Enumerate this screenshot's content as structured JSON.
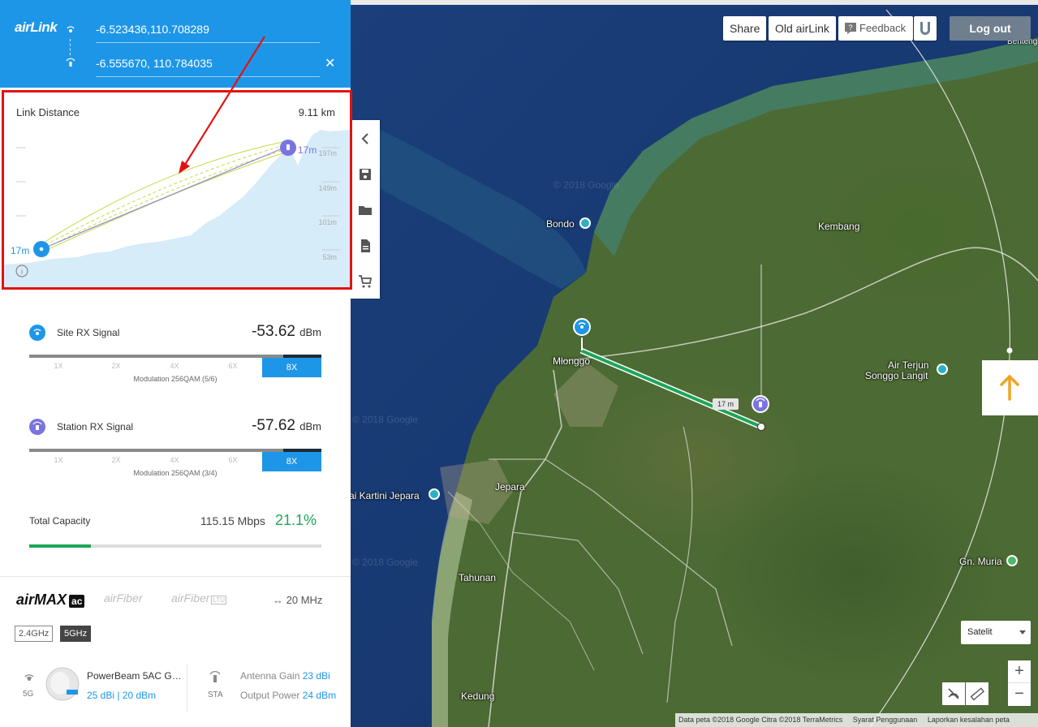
{
  "header": {
    "logo": "airLink",
    "site_coord": "-6.523436,110.708289",
    "station_coord": "-6.555670, 110.784035",
    "clear_label": "✕"
  },
  "profile": {
    "title": "Link Distance",
    "distance": "9.11 km",
    "site_height": "17m",
    "station_height": "17m",
    "elevation_ticks": [
      "197m",
      "149m",
      "101m",
      "53m"
    ]
  },
  "site_rx": {
    "label": "Site RX Signal",
    "value": "-53.62",
    "unit": "dBm",
    "ticks": [
      "1X",
      "2X",
      "4X",
      "6X"
    ],
    "active": "8X",
    "modulation": "Modulation 256QAM (5/6)"
  },
  "station_rx": {
    "label": "Station RX Signal",
    "value": "-57.62",
    "unit": "dBm",
    "ticks": [
      "1X",
      "2X",
      "4X",
      "6X"
    ],
    "active": "8X",
    "modulation": "Modulation 256QAM (3/4)"
  },
  "capacity": {
    "label": "Total Capacity",
    "mbps": "115.15 Mbps",
    "percent": "21.1%",
    "fraction": 0.211
  },
  "products": {
    "airmax": "airMAX",
    "airmax_suffix": "ac",
    "airfiber": "airFiber",
    "airfiber_ltu": "airFiber",
    "ltu": "LTU",
    "bandwidth": "20 MHz",
    "bands": [
      "2.4GHz",
      "5GHz"
    ]
  },
  "device": {
    "band": "5G",
    "name": "PowerBeam 5AC Ge...",
    "spec": "25 dBi | 20 dBm",
    "mode": "STA",
    "antenna_gain_label": "Antenna Gain",
    "antenna_gain": "23 dBi",
    "output_power_label": "Output Power",
    "output_power": "24 dBm"
  },
  "tools": [
    "chevron-left-icon",
    "save-icon",
    "folder-icon",
    "document-icon",
    "cart-icon"
  ],
  "map": {
    "buttons": {
      "share": "Share",
      "old": "Old airLink",
      "feedback": "Feedback",
      "logout": "Log out"
    },
    "places": {
      "benteng": "Benteng Portu",
      "bondo": "Bondo",
      "kembang": "Kembang",
      "mlonggo": "Mlonggo",
      "air_terjun": "Air Terjun",
      "songgo": "Songgo Langit",
      "kartini": "ai Kartini Jepara",
      "jepara": "Jepara",
      "tahunan": "Tahunan",
      "muria": "Gn. Muria",
      "kedung": "Kedung"
    },
    "link_label": "17 m",
    "map_type": "Satelit",
    "zoom_in": "+",
    "zoom_out": "−",
    "watermark": "© 2018 Google",
    "attribution": [
      "Data peta ©2018 Google Citra ©2018 TerraMetrics",
      "Syarat Penggunaan",
      "Laporkan kesalahan peta"
    ]
  },
  "colors": {
    "brand_blue": "#1e96e8",
    "station_purple": "#7a73e0",
    "capacity_green": "#1ea55a",
    "highlight_red": "#e31212"
  }
}
